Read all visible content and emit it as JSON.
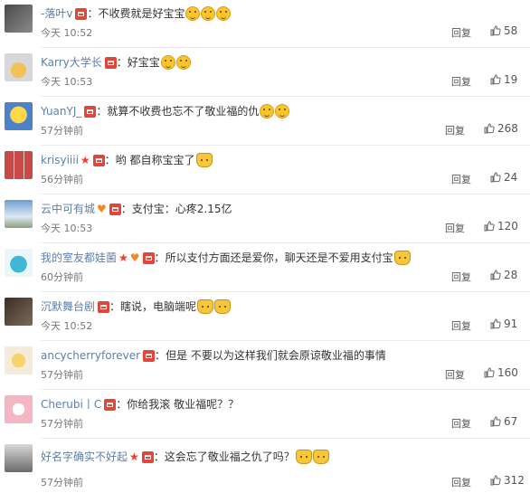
{
  "reply_label": "回复",
  "comments": [
    {
      "user": "-落叶v",
      "text": "不收费就是好宝宝",
      "time": "今天 10:52",
      "likes": "58",
      "emojis": 3,
      "emoji_kind": "face"
    },
    {
      "user": "Karry大学长",
      "text": "好宝宝",
      "time": "今天 10:53",
      "likes": "19",
      "emojis": 2,
      "emoji_kind": "face"
    },
    {
      "user": "YuanYJ_",
      "text": "就算不收费也忘不了敬业福的仇",
      "time": "57分钟前",
      "likes": "268",
      "emojis": 2,
      "emoji_kind": "face"
    },
    {
      "user": "krisyiiii",
      "text": "哟 都自称宝宝了",
      "time": "56分钟前",
      "likes": "24",
      "emojis": 1,
      "emoji_kind": "cat",
      "star": true
    },
    {
      "user": "云中可有城",
      "text": "支付宝：心疼2.15亿",
      "time": "今天 10:53",
      "likes": "120",
      "emojis": 0,
      "heart_badge": true
    },
    {
      "user": "我的室友都娃菌",
      "text": "所以支付方面还是爱你，聊天还是不爱用支付宝",
      "time": "60分钟前",
      "likes": "28",
      "emojis": 1,
      "emoji_kind": "cat",
      "star": true,
      "heart_badge": true
    },
    {
      "user": "沉默舞台剧",
      "text": "瞎说，电脑端呢",
      "time": "今天 10:52",
      "likes": "91",
      "emojis": 2,
      "emoji_kind": "cat"
    },
    {
      "user": "ancycherryforever",
      "text": "但是 不要以为这样我们就会原谅敬业福的事情",
      "time": "57分钟前",
      "likes": "160",
      "emojis": 0
    },
    {
      "user": "Cherubi丨C",
      "text": "你给我滚 敬业福呢？？",
      "time": "57分钟前",
      "likes": "67",
      "emojis": 0
    },
    {
      "user": "好名字确实不好起",
      "text": "这会忘了敬业福之仇了吗？",
      "time": "57分钟前",
      "likes": "312",
      "emojis": 2,
      "emoji_kind": "cat",
      "star": true
    }
  ],
  "colors": {
    "username": "#5d7fa8",
    "badge": "#e2463b",
    "text": "#333333",
    "meta": "#777777"
  }
}
